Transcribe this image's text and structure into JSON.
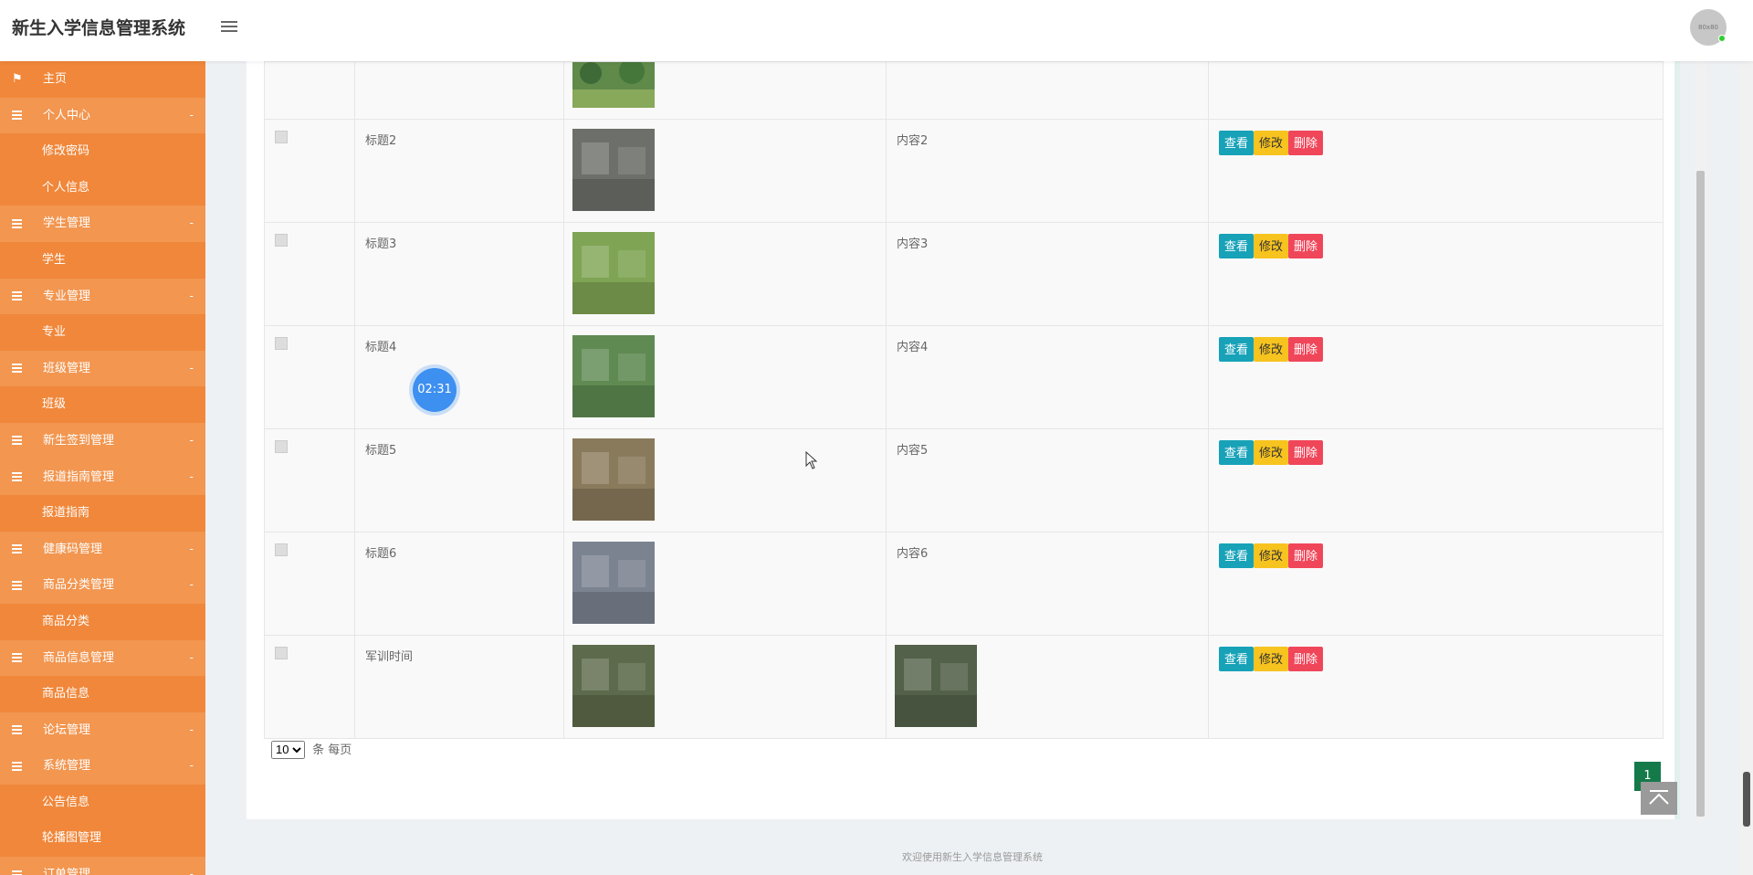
{
  "header": {
    "title": "新生入学信息管理系统",
    "avatar_text": "80x80"
  },
  "sidebar": {
    "items": [
      {
        "label": "主页",
        "type": "home",
        "icon": "flag-icon"
      },
      {
        "label": "个人中心",
        "type": "group"
      },
      {
        "label": "修改密码",
        "type": "sub"
      },
      {
        "label": "个人信息",
        "type": "sub"
      },
      {
        "label": "学生管理",
        "type": "group"
      },
      {
        "label": "学生",
        "type": "sub"
      },
      {
        "label": "专业管理",
        "type": "group"
      },
      {
        "label": "专业",
        "type": "sub"
      },
      {
        "label": "班级管理",
        "type": "group"
      },
      {
        "label": "班级",
        "type": "sub"
      },
      {
        "label": "新生签到管理",
        "type": "group"
      },
      {
        "label": "报道指南管理",
        "type": "group"
      },
      {
        "label": "报道指南",
        "type": "sub"
      },
      {
        "label": "健康码管理",
        "type": "group"
      },
      {
        "label": "商品分类管理",
        "type": "group"
      },
      {
        "label": "商品分类",
        "type": "sub"
      },
      {
        "label": "商品信息管理",
        "type": "group"
      },
      {
        "label": "商品信息",
        "type": "sub"
      },
      {
        "label": "论坛管理",
        "type": "group"
      },
      {
        "label": "系统管理",
        "type": "group"
      },
      {
        "label": "公告信息",
        "type": "sub"
      },
      {
        "label": "轮播图管理",
        "type": "sub"
      },
      {
        "label": "订单管理",
        "type": "group"
      }
    ],
    "arrow": "-"
  },
  "table": {
    "rows": [
      {
        "title": "标题2",
        "content": "内容2",
        "img_color": "#6d6f6a"
      },
      {
        "title": "标题3",
        "content": "内容3",
        "img_color": "#7fa454"
      },
      {
        "title": "标题4",
        "content": "内容4",
        "img_color": "#5f8a52"
      },
      {
        "title": "标题5",
        "content": "内容5",
        "img_color": "#8a7a5c"
      },
      {
        "title": "标题6",
        "content": "内容6",
        "img_color": "#7b8391"
      },
      {
        "title": "军训时间",
        "content": "",
        "img_color": "#5d6a4b",
        "content_img_color": "#54614a"
      }
    ],
    "actions": {
      "view": "查看",
      "edit": "修改",
      "delete": "删除"
    }
  },
  "pager": {
    "page_size": "10",
    "suffix": "条 每页",
    "current_page": "1"
  },
  "timer": "02:31",
  "footer": "欢迎使用新生入学信息管理系统"
}
